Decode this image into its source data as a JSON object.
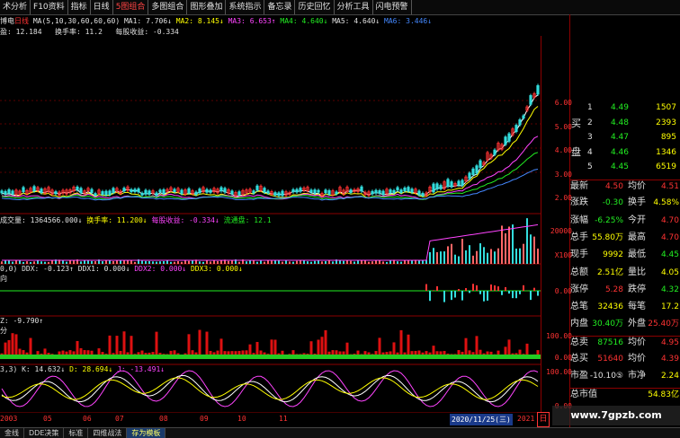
{
  "toolbar": [
    "术分析",
    "F10资料",
    "指标",
    "日线",
    "5图组合",
    "多图组合",
    "图形叠加",
    "系统指示",
    "备忘录",
    "历史回忆",
    "分析工具",
    "闪电预警"
  ],
  "header": {
    "stock": "博电",
    "period": "日线",
    "ma_params": "MA(5,10,30,60,60,60)",
    "ma1": "MA1: 7.706↓",
    "ma2": "MA2: 8.145↓",
    "ma3": "MA3: 6.653↑",
    "ma4": "MA4: 4.640↓",
    "ma5": "MA5: 4.640↓",
    "ma6": "MA6: 3.446↓",
    "pe": "盈: 12.184",
    "turnover": "换手率: 11.2",
    "eps": "每股收益: -0.334"
  },
  "price_axis": [
    "6.00",
    "5.00",
    "4.00",
    "3.00",
    "2.00"
  ],
  "vol_indicator": {
    "volume": "成交量: 1364566.000↓",
    "turnover": "换手率: 11.200↓",
    "eps": "每股收益: -0.334↓",
    "float": "流通盘: 12.1",
    "axis_top": "20000",
    "axis_unit": "X100"
  },
  "ddx_indicator": {
    "params": "0,0)",
    "ddx": "DDX: -0.123↑",
    "ddx1": "DDX1: 0.000↓",
    "ddx2": "DDX2: 0.000↓",
    "ddx3": "DDX3: 0.000↓",
    "label": "向",
    "axis": "0.00"
  },
  "z_indicator": {
    "z": "Z: -9.790↑",
    "label": "分",
    "axis_top": "100.00",
    "axis_zero": "0.00"
  },
  "kdj_indicator": {
    "params": "3,3)",
    "k": "K: 14.632↓",
    "d": "D: 28.694↓",
    "j": "J: -13.491↓",
    "axis_top": "100.00",
    "axis_bottom": "0.00"
  },
  "date_axis": [
    "2003",
    "05",
    "06",
    "07",
    "08",
    "09",
    "10",
    "11"
  ],
  "date_highlight": "2020/11/25(三)",
  "date_end": "2021",
  "date_tab": "日",
  "order_book": {
    "sell_label": "买",
    "buy_label": "盘",
    "rows": [
      {
        "n": "1",
        "price": "4.49",
        "vol": "1507"
      },
      {
        "n": "2",
        "price": "4.48",
        "vol": "2393"
      },
      {
        "n": "3",
        "price": "4.47",
        "vol": "895"
      },
      {
        "n": "4",
        "price": "4.46",
        "vol": "1346"
      },
      {
        "n": "5",
        "price": "4.45",
        "vol": "6519"
      }
    ]
  },
  "quote": [
    {
      "l1": "最新",
      "v1": "4.50",
      "l2": "均价",
      "v2": "4.51",
      "c1": "r",
      "c2": "r"
    },
    {
      "l1": "涨跌",
      "v1": "-0.30",
      "l2": "换手",
      "v2": "4.58%",
      "c1": "g",
      "c2": "y"
    },
    {
      "l1": "涨幅",
      "v1": "-6.25%",
      "l2": "今开",
      "v2": "4.70",
      "c1": "g",
      "c2": "r"
    },
    {
      "l1": "总手",
      "v1": "55.80万",
      "l2": "最高",
      "v2": "4.70",
      "c1": "y",
      "c2": "r"
    },
    {
      "l1": "现手",
      "v1": "9992",
      "l2": "最低",
      "v2": "4.45",
      "c1": "y",
      "c2": "g"
    },
    {
      "l1": "总额",
      "v1": "2.51亿",
      "l2": "量比",
      "v2": "4.05",
      "c1": "y",
      "c2": "y"
    },
    {
      "l1": "涨停",
      "v1": "5.28",
      "l2": "跌停",
      "v2": "4.32",
      "c1": "r",
      "c2": "g"
    },
    {
      "l1": "总笔",
      "v1": "32436",
      "l2": "每笔",
      "v2": "17.2",
      "c1": "y",
      "c2": "y"
    },
    {
      "l1": "内盘",
      "v1": "30.40万",
      "l2": "外盘",
      "v2": "25.40万",
      "c1": "g",
      "c2": "r"
    },
    {
      "l1": "总卖",
      "v1": "87516",
      "l2": "均价",
      "v2": "4.95",
      "c1": "g",
      "c2": "r"
    },
    {
      "l1": "总买",
      "v1": "51640",
      "l2": "均价",
      "v2": "4.39",
      "c1": "r",
      "c2": "r"
    },
    {
      "l1": "市盈",
      "v1": "-10.10⑤",
      "l2": "市净",
      "v2": "2.24",
      "c1": "w",
      "c2": "y"
    },
    {
      "l1": "总市值",
      "v1": "",
      "l2": "",
      "v2": "54.83亿",
      "c1": "w",
      "c2": "y"
    }
  ],
  "watermark": "www.7gpzb.com",
  "bottom_tabs": [
    "金线",
    "DDE决策",
    "标准",
    "四维战法",
    "存为模板"
  ],
  "colors": {
    "up": "#ff3333",
    "down": "#33dddd",
    "grid": "#8b0000",
    "text_yellow": "#ffff00"
  }
}
